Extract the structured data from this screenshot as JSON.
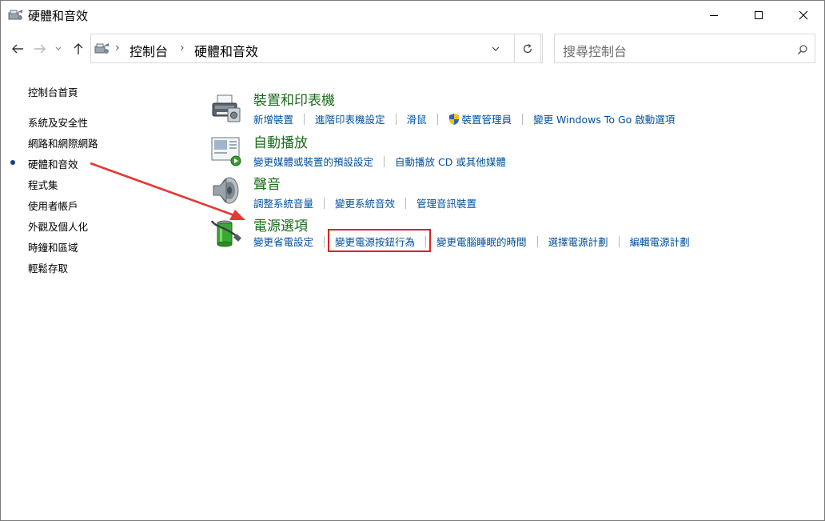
{
  "window": {
    "title": "硬體和音效"
  },
  "address": {
    "crumbs": [
      "控制台",
      "硬體和音效"
    ]
  },
  "search": {
    "placeholder": "搜尋控制台"
  },
  "leftnav": {
    "items": [
      {
        "label": "控制台首頁"
      },
      {
        "label": "系統及安全性"
      },
      {
        "label": "網路和網際網路"
      },
      {
        "label": "硬體和音效",
        "current": true
      },
      {
        "label": "程式集"
      },
      {
        "label": "使用者帳戶"
      },
      {
        "label": "外觀及個人化"
      },
      {
        "label": "時鐘和區域"
      },
      {
        "label": "輕鬆存取"
      }
    ]
  },
  "categories": [
    {
      "title": "裝置和印表機",
      "icon": "printer-icon",
      "links": [
        "新增裝置",
        "進階印表機設定",
        "滑鼠",
        "裝置管理員",
        "變更 Windows To Go 啟動選項"
      ]
    },
    {
      "title": "自動播放",
      "icon": "autoplay-icon",
      "links": [
        "變更媒體或裝置的預設設定",
        "自動播放 CD 或其他媒體"
      ]
    },
    {
      "title": "聲音",
      "icon": "speaker-icon",
      "links": [
        "調整系統音量",
        "變更系統音效",
        "管理音訊裝置"
      ]
    },
    {
      "title": "電源選項",
      "icon": "battery-icon",
      "links": [
        "變更省電設定",
        "變更電源按鈕行為",
        "變更電腦睡眠的時間",
        "選擇電源計劃",
        "編輯電源計劃"
      ]
    }
  ],
  "colors": {
    "category_title": "#1a6b1a",
    "link": "#0050a0",
    "highlight": "#e02020",
    "arrow": "#e53935"
  }
}
